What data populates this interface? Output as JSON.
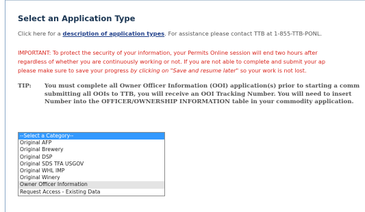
{
  "header": {
    "title": "Select an Application Type"
  },
  "info": {
    "prefix": "Click here for a ",
    "link_text": "description of application types",
    "suffix": ".  For assistance please contact TTB at 1-855-TTB-PONL."
  },
  "important": {
    "line1": "IMPORTANT: To protect the security of your information, your Permits Online session will end two hours after",
    "line2": "regardless of whether you are continuously working or not. If you are not able to complete and submit your ap",
    "line3_prefix": "please make sure to save your progress ",
    "line3_em": "by clicking on \"Save and resume later\"",
    "line3_suffix": " so your work is not lost."
  },
  "tip": {
    "label": "TIP:",
    "line1": "You must complete all Owner Officer Information (OOI) application(s) prior to starting a comm",
    "line2": "submitting all OOIs to TTB, you will receive an OOI Tracking Number.  You will need to insert",
    "line3": "Number into the OFFICER/OWNERSHIP INFORMATION table in your commodity application."
  },
  "category_select": {
    "selected": "--Select a Category--",
    "options": [
      "--Select a Category--",
      "Original AFP",
      "Original Brewery",
      "Original DSP",
      "Original SDS TFA USGOV",
      "Original WHL IMP",
      "Original Winery",
      "Owner Officer Information",
      "Request Access - Existing Data"
    ]
  },
  "colors": {
    "selected_bg": "#3399ff",
    "important_text": "#d8241c",
    "title_text": "#1a3552"
  }
}
